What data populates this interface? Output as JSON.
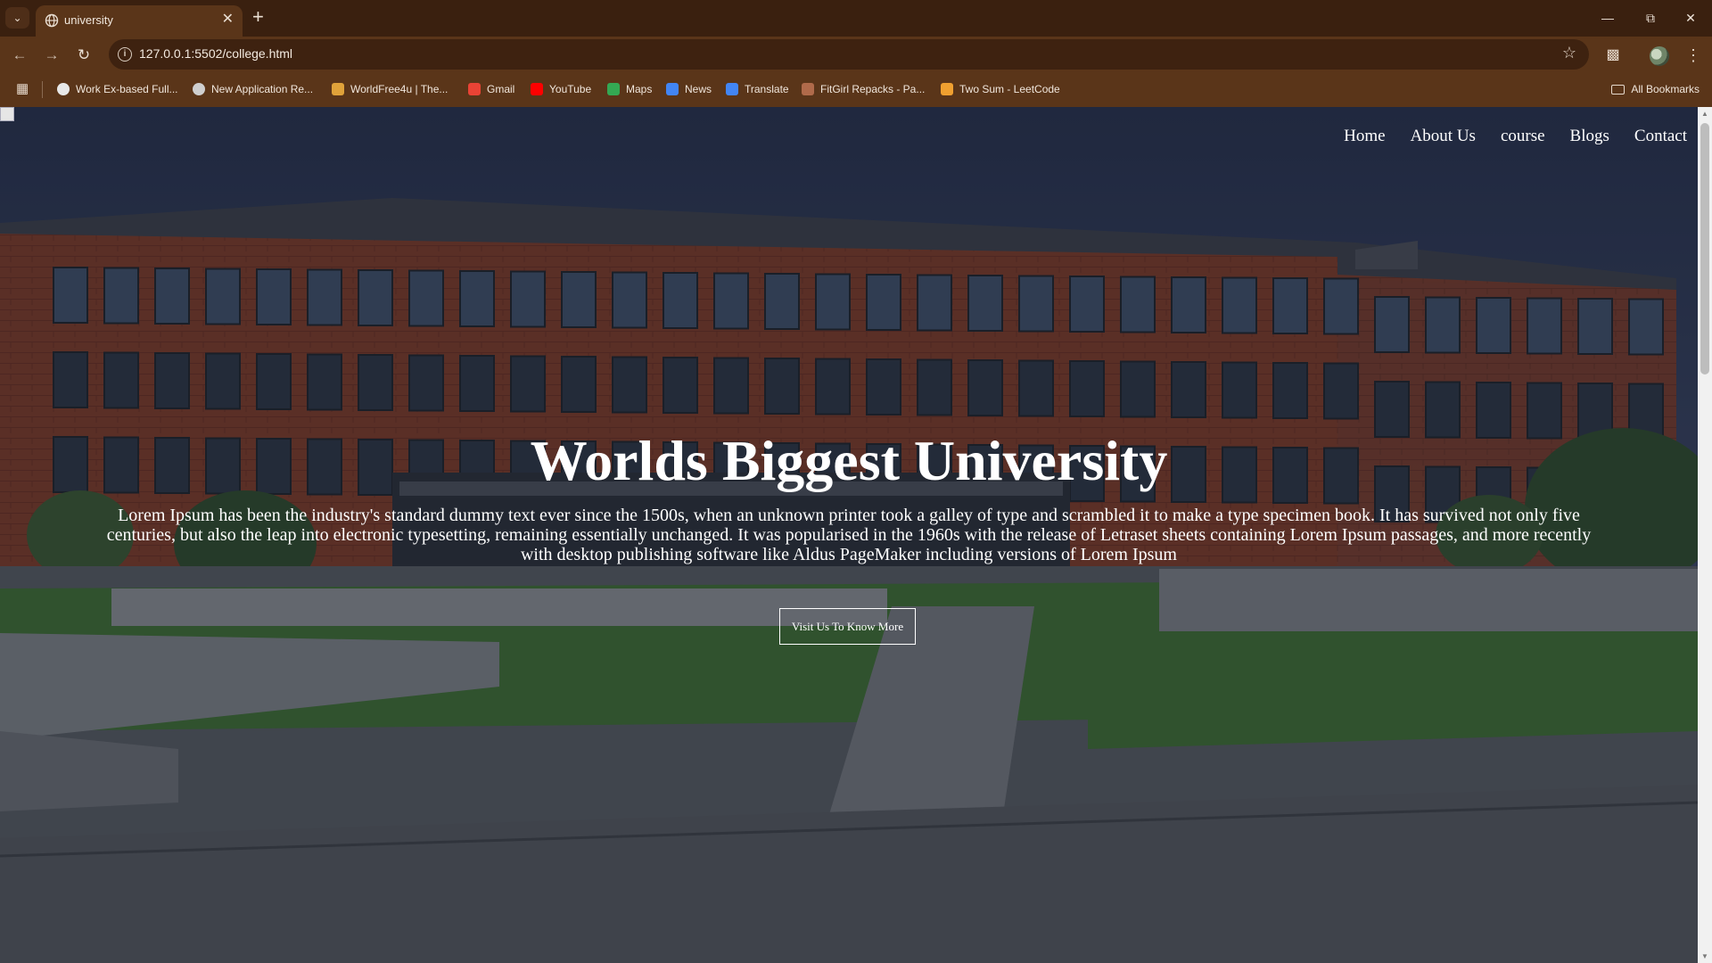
{
  "browser": {
    "tab": {
      "title": "university"
    },
    "url": "127.0.0.1:5502/college.html",
    "bookmarks": [
      {
        "label": "Work Ex-based Full...",
        "icon": "globe-icon",
        "color": "#e8e8e8"
      },
      {
        "label": "New Application Re...",
        "icon": "globe-icon",
        "color": "#cfcfcf"
      },
      {
        "label": "WorldFree4u | The...",
        "icon": "worldfree-icon",
        "color": "#e0a23a"
      },
      {
        "label": "Gmail",
        "icon": "gmail-icon",
        "color": "#ea4335"
      },
      {
        "label": "YouTube",
        "icon": "youtube-icon",
        "color": "#ff0000"
      },
      {
        "label": "Maps",
        "icon": "maps-icon",
        "color": "#34a853"
      },
      {
        "label": "News",
        "icon": "news-icon",
        "color": "#4285f4"
      },
      {
        "label": "Translate",
        "icon": "translate-icon",
        "color": "#4285f4"
      },
      {
        "label": "FitGirl Repacks - Pa...",
        "icon": "fitgirl-icon",
        "color": "#b06a4a"
      },
      {
        "label": "Two Sum - LeetCode",
        "icon": "leetcode-icon",
        "color": "#f0a030"
      }
    ],
    "all_bookmarks_label": "All Bookmarks"
  },
  "page": {
    "nav": [
      "Home",
      "About Us",
      "course",
      "Blogs",
      "Contact"
    ],
    "headline": "Worlds Biggest University",
    "lead": "Lorem Ipsum has been the industry's standard dummy text ever since the 1500s, when an unknown printer took a galley of type and scrambled it to make a type specimen book. It has survived not only five centuries, but also the leap into electronic typesetting, remaining essentially unchanged. It was popularised in the 1960s with the release of Letraset sheets containing Lorem Ipsum passages, and more recently with desktop publishing software like Aldus PageMaker including versions of Lorem Ipsum",
    "cta": "Visit Us To Know More"
  }
}
